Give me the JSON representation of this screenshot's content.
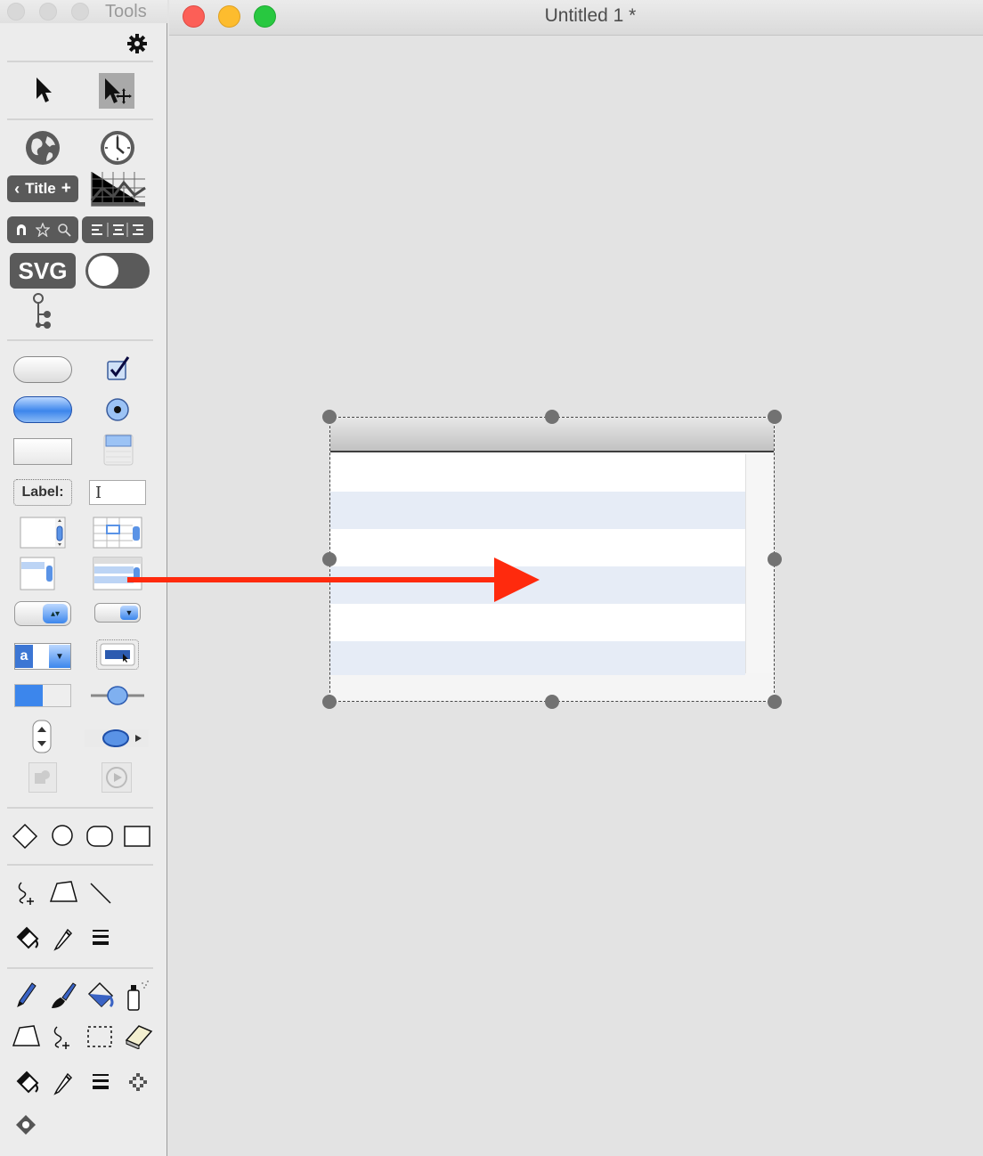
{
  "tools_window": {
    "title": "Tools",
    "label_tool_text": "Label:",
    "svg_tool_text": "SVG",
    "title_bar_tool_text": "Title"
  },
  "document_window": {
    "title": "Untitled 1 *",
    "traffic_colors": {
      "close": "#fc5f57",
      "minimize": "#fdbc2e",
      "zoom": "#28c840"
    }
  },
  "canvas": {
    "selected_object": "table-view",
    "table_rows": [
      "even",
      "odd",
      "even",
      "odd",
      "even",
      "odd"
    ],
    "drag_arrow_color": "#ff2a0d"
  }
}
